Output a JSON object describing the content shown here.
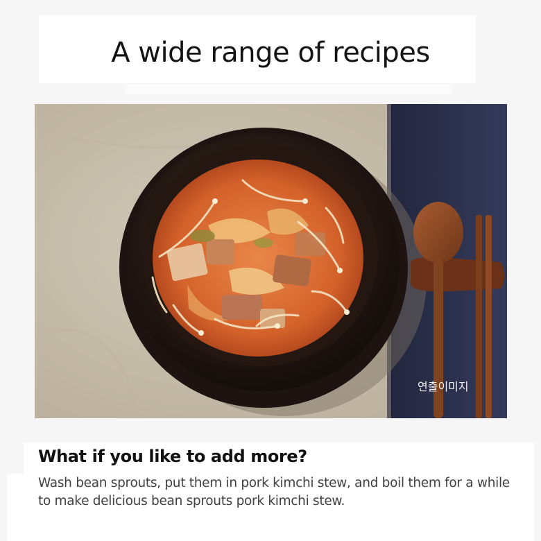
{
  "header": {
    "title": "A wide range of recipes"
  },
  "photo": {
    "subject": "bean sprouts pork kimchi stew",
    "watermark": "연출이미지",
    "colors": {
      "tablecloth": "#c9bfad",
      "placemat": "#2b2f4a",
      "bowl": "#2a1c16",
      "broth": "#d86a2c",
      "wood": "#8a4a26"
    }
  },
  "caption": {
    "heading": "What if you like to add more?",
    "body": "Wash bean sprouts, put them in pork kimchi stew, and boil them for a while to make delicious bean sprouts pork kimchi stew."
  }
}
